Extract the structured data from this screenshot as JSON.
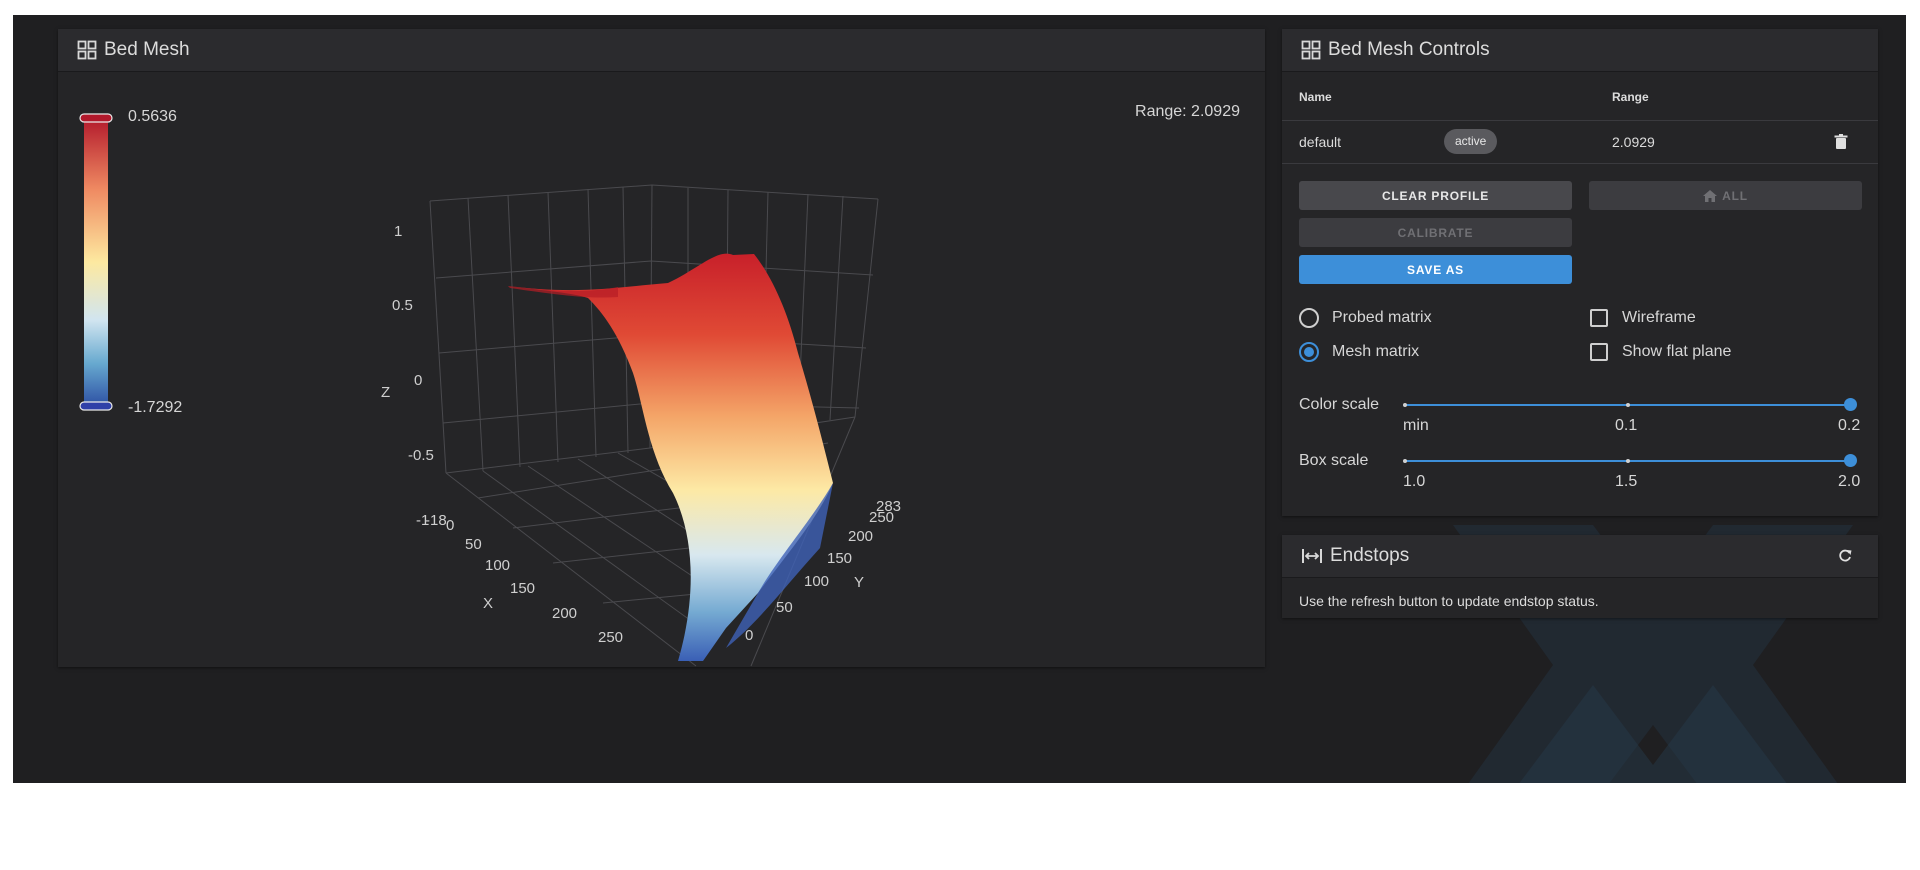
{
  "colors": {
    "accent": "#3d8fd9",
    "panel": "#252527",
    "background": "#1f1f21"
  },
  "bed_mesh": {
    "title": "Bed Mesh",
    "icon": "grid-icon",
    "range_text": "Range: 2.0929",
    "color_bar": {
      "max": "0.5636",
      "min": "-1.7292"
    },
    "plot": {
      "z_ticks": [
        "1",
        "0.5",
        "0",
        "-0.5",
        "-1"
      ],
      "z_label": "Z",
      "x_ticks": [
        "-18",
        "0",
        "50",
        "100",
        "150",
        "200",
        "250"
      ],
      "x_label": "X",
      "y_ticks": [
        "283",
        "250",
        "200",
        "150",
        "100",
        "50",
        "0"
      ],
      "y_label": "Y"
    }
  },
  "controls": {
    "title": "Bed Mesh Controls",
    "icon": "grid-icon",
    "table": {
      "headers": {
        "name": "Name",
        "range": "Range"
      },
      "rows": [
        {
          "name": "default",
          "badge": "active",
          "range": "2.0929"
        }
      ]
    },
    "buttons": {
      "clear_profile": "CLEAR PROFILE",
      "home_all": "ALL",
      "calibrate": "CALIBRATE",
      "save_as": "SAVE AS"
    },
    "options": {
      "probed_matrix": "Probed matrix",
      "mesh_matrix": "Mesh matrix",
      "selected_matrix": "Mesh matrix",
      "wireframe": "Wireframe",
      "show_flat_plane": "Show flat plane",
      "wireframe_checked": false,
      "flat_plane_checked": false
    },
    "color_scale": {
      "label": "Color scale",
      "ticks": [
        "min",
        "0.1",
        "0.2"
      ],
      "value": "0.2"
    },
    "box_scale": {
      "label": "Box scale",
      "ticks": [
        "1.0",
        "1.5",
        "2.0"
      ],
      "value": "2.0"
    }
  },
  "endstops": {
    "title": "Endstops",
    "icon": "endstops-icon",
    "message": "Use the refresh button to update endstop status."
  }
}
